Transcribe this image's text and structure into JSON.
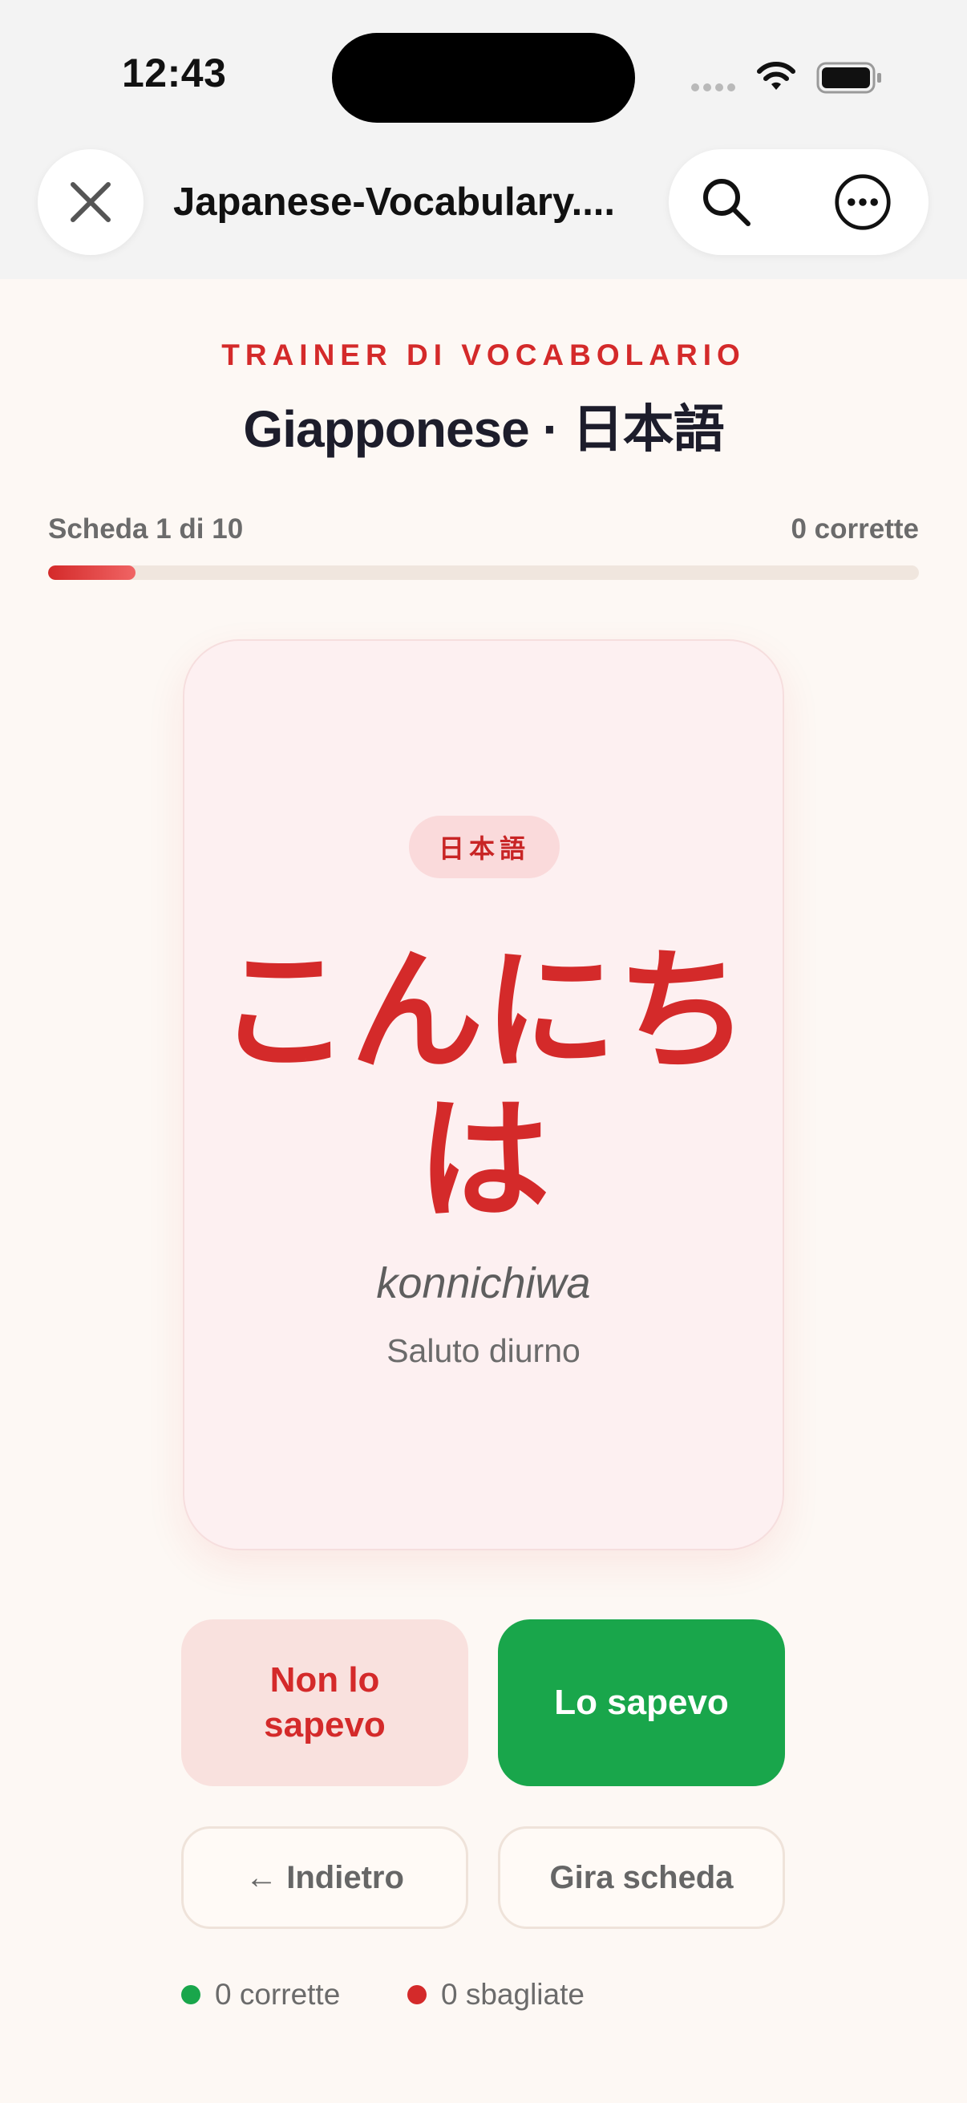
{
  "status_bar": {
    "time": "12:43"
  },
  "browser": {
    "page_title": "Japanese-Vocabulary....",
    "icons": [
      "close-icon",
      "search-icon",
      "more-icon"
    ]
  },
  "header": {
    "eyebrow": "TRAINER DI VOCABOLARIO",
    "title": "Giapponese · 日本語"
  },
  "progress": {
    "card_label": "Scheda 1 di 10",
    "correct_label": "0 corrette",
    "fraction": 0.1
  },
  "card": {
    "language_badge": "日本語",
    "word": "こんにちは",
    "romaji": "konnichiwa",
    "meaning": "Saluto diurno"
  },
  "actions": {
    "wrong_label": "Non lo sapevo",
    "right_label": "Lo sapevo",
    "back_label": "← Indietro",
    "flip_label": "Gira scheda"
  },
  "score": {
    "correct": "0 corrette",
    "wrong": "0 sbagliate"
  },
  "colors": {
    "accent_red": "#d42a2a",
    "success_green": "#19a64b",
    "background": "#fdf8f4",
    "card_background": "#fdf0f1"
  }
}
